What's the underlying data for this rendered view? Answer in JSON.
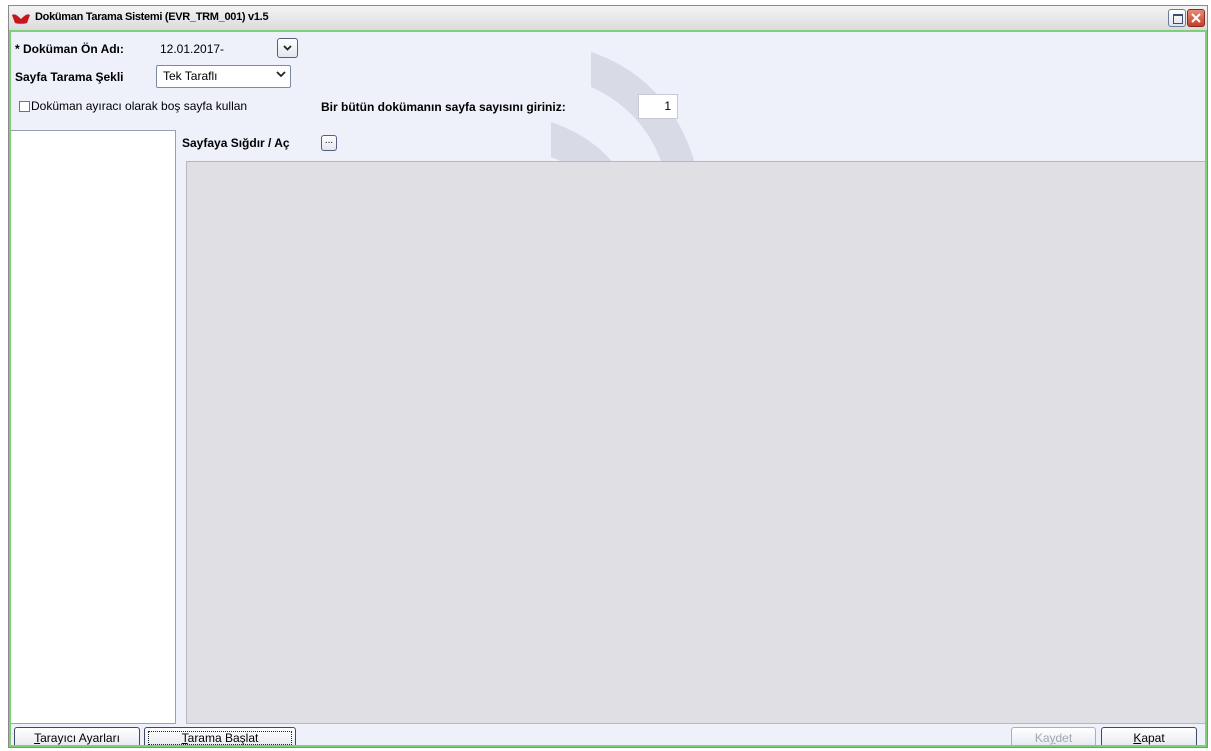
{
  "window": {
    "title": "Doküman Tarama Sistemi (EVR_TRM_001) v1.5"
  },
  "form": {
    "doc_name_label": "* Doküman Ön Adı:",
    "doc_name_value": "12.01.2017-",
    "scan_mode_label": "Sayfa Tarama Şekli",
    "scan_mode_value": "Tek Taraflı",
    "separator_checkbox_label": "Doküman ayıracı olarak boş sayfa kullan",
    "separator_checked": false,
    "page_count_label": "Bir bütün dokümanın sayfa sayısını giriniz:",
    "page_count_value": "1",
    "fit_label": "Sayfaya Sığdır / Aç",
    "fit_button_label": "..."
  },
  "buttons": {
    "scanner_settings": {
      "mnemonic": "T",
      "rest": "arayıcı Ayarları"
    },
    "start_scan": {
      "mnemonic": "T",
      "rest": "arama Başlat"
    },
    "save": {
      "pre": "Ka",
      "mnemonic": "y",
      "rest": "det"
    },
    "close": {
      "mnemonic": "K",
      "rest": "apat"
    }
  },
  "colors": {
    "client_border": "#7fce78",
    "background": "#eef0fa",
    "preview_bg": "#e0dfe4"
  },
  "icons": {
    "app": "app-logo-icon",
    "maximize": "maximize-icon",
    "close": "close-icon",
    "dropdown": "chevron-down-icon"
  }
}
